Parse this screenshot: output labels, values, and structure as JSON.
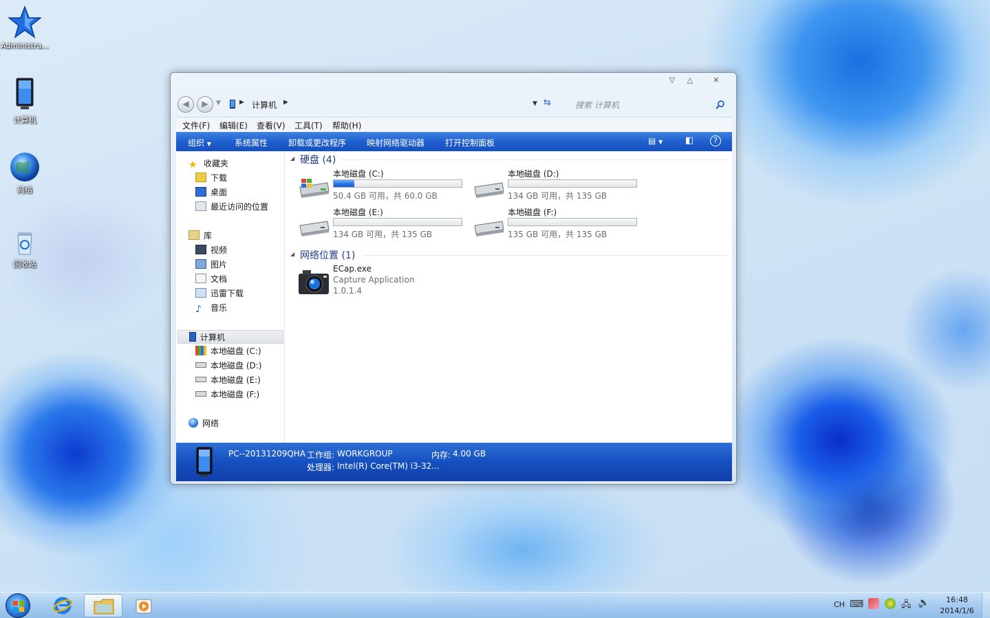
{
  "desktop": {
    "icons": [
      {
        "label": "Administra..."
      },
      {
        "label": "计算机"
      },
      {
        "label": "网络"
      },
      {
        "label": "回收站"
      }
    ]
  },
  "window": {
    "address": "计算机",
    "search_placeholder": "搜索 计算机",
    "menu": [
      "文件(F)",
      "编辑(E)",
      "查看(V)",
      "工具(T)",
      "帮助(H)"
    ],
    "toolbar": [
      "组织",
      "系统属性",
      "卸载或更改程序",
      "映射网络驱动器",
      "打开控制面板"
    ],
    "nav": {
      "favorites": {
        "label": "收藏夹",
        "items": [
          "下载",
          "桌面",
          "最近访问的位置"
        ]
      },
      "libraries": {
        "label": "库",
        "items": [
          "视频",
          "图片",
          "文档",
          "迅雷下载",
          "音乐"
        ]
      },
      "computer": {
        "label": "计算机",
        "items": [
          "本地磁盘 (C:)",
          "本地磁盘 (D:)",
          "本地磁盘 (E:)",
          "本地磁盘 (F:)"
        ]
      },
      "network": {
        "label": "网络"
      }
    },
    "content": {
      "drives_header": "硬盘 (4)",
      "drives": [
        {
          "name": "本地磁盘 (C:)",
          "free": "50.4 GB 可用，共 60.0 GB",
          "used_fraction": 0.16
        },
        {
          "name": "本地磁盘 (D:)",
          "free": "134 GB 可用，共 135 GB",
          "used_fraction": 0.0
        },
        {
          "name": "本地磁盘 (E:)",
          "free": "134 GB 可用，共 135 GB",
          "used_fraction": 0.0
        },
        {
          "name": "本地磁盘 (F:)",
          "free": "135 GB 可用，共 135 GB",
          "used_fraction": 0.0
        }
      ],
      "network_header": "网络位置 (1)",
      "network_item": {
        "name": "ECap.exe",
        "desc": "Capture Application",
        "version": "1.0.1.4"
      }
    },
    "details": {
      "computer_name": "PC--20131209QHA",
      "workgroup_label": "工作组:",
      "workgroup": "WORKGROUP",
      "memory_label": "内存:",
      "memory": "4.00 GB",
      "cpu_label": "处理器:",
      "cpu": "Intel(R) Core(TM) i3-32..."
    }
  },
  "taskbar": {
    "lang": "CH",
    "time": "16:48",
    "date": "2014/1/6"
  }
}
